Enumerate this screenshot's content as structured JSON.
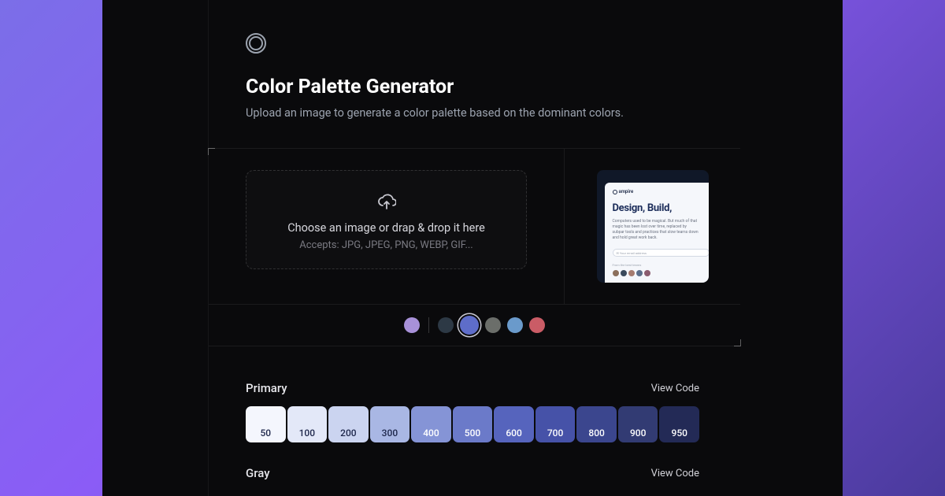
{
  "header": {
    "title": "Color Palette Generator",
    "subtitle": "Upload an image to generate a color palette based on the dominant colors."
  },
  "upload": {
    "main": "Choose an image or drap & drop it here",
    "sub": "Accepts: JPG, JPEG, PNG, WEBP, GIF..."
  },
  "preview": {
    "brand": "ampire",
    "headline": "Design, Build,",
    "para": "Computers used to be magical. But much of that magic has been lost over time, replaced by subpar tools and practices that slow teams down and hold great work back.",
    "placeholder": "Your email address"
  },
  "swatches": {
    "main": "#a891d9",
    "options": [
      {
        "color": "#2d3945"
      },
      {
        "color": "#5e6dc9",
        "selected": true
      },
      {
        "color": "#6b6e6a"
      },
      {
        "color": "#6a9acb"
      },
      {
        "color": "#ca5c66"
      }
    ]
  },
  "palettes": [
    {
      "name": "Primary",
      "action": "View Code",
      "shades": [
        {
          "label": "50",
          "bg": "#f4f6fd",
          "fg": "#1d264a"
        },
        {
          "label": "100",
          "bg": "#e3e8f8",
          "fg": "#1d264a"
        },
        {
          "label": "200",
          "bg": "#cbd4f0",
          "fg": "#1d264a"
        },
        {
          "label": "300",
          "bg": "#a9b7e4",
          "fg": "#1d264a"
        },
        {
          "label": "400",
          "bg": "#8594d6",
          "fg": "#fff"
        },
        {
          "label": "500",
          "bg": "#6b7ac9",
          "fg": "#fff"
        },
        {
          "label": "600",
          "bg": "#5664bd",
          "fg": "#fff"
        },
        {
          "label": "700",
          "bg": "#4652a8",
          "fg": "#fff"
        },
        {
          "label": "800",
          "bg": "#3b468e",
          "fg": "#fff"
        },
        {
          "label": "900",
          "bg": "#323b73",
          "fg": "#fff"
        },
        {
          "label": "950",
          "bg": "#232a56",
          "fg": "#fff"
        }
      ]
    },
    {
      "name": "Gray",
      "action": "View Code"
    }
  ]
}
